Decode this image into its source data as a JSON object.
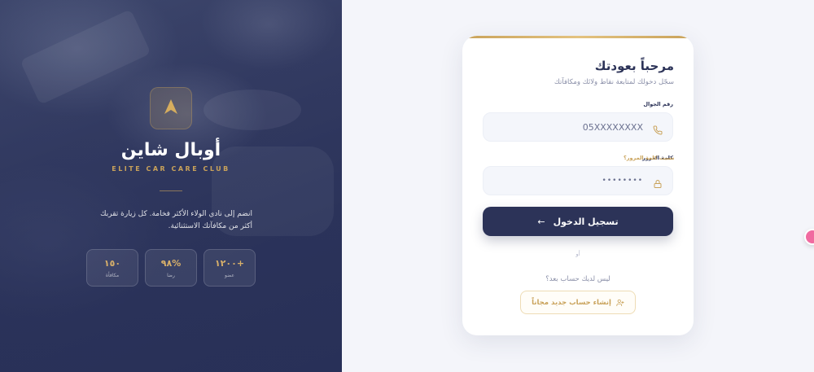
{
  "brand": {
    "title": "أوبال شاين",
    "subtitle": "ELITE CAR CARE CLUB",
    "description": "انضم إلى نادي الولاء الأكثر فخامة. كل زيارة تقربك أكثر من مكافآتك الاستثنائية.",
    "accent_color": "#c9a25a",
    "primary_color": "#2c3358",
    "logo_icon": "arrow-up-logo-icon"
  },
  "stats": [
    {
      "value": "+١٢٠٠",
      "label": "عضو"
    },
    {
      "value": "%٩٨",
      "label": "رضا"
    },
    {
      "value": "١٥٠",
      "label": "مكافأة"
    }
  ],
  "login": {
    "title": "مرحباً بعودتك",
    "subtitle": "سجّل دخولك لمتابعة نقاط ولائك ومكافآتك",
    "phone_label": "رقم الجوال",
    "phone_placeholder": "05XXXXXXXX",
    "phone_icon": "phone-icon",
    "password_label": "كلمة المرور",
    "password_placeholder": "••••••••",
    "password_icon": "lock-icon",
    "forgot_link": "نسيت كلمة المرور؟",
    "submit_label": "تسجيل الدخول",
    "submit_icon": "arrow-left-icon",
    "or_text": "أو",
    "no_account_text": "ليس لديك حساب بعد؟",
    "signup_label": "إنشاء حساب جديد مجاناً",
    "signup_icon": "user-plus-icon"
  }
}
